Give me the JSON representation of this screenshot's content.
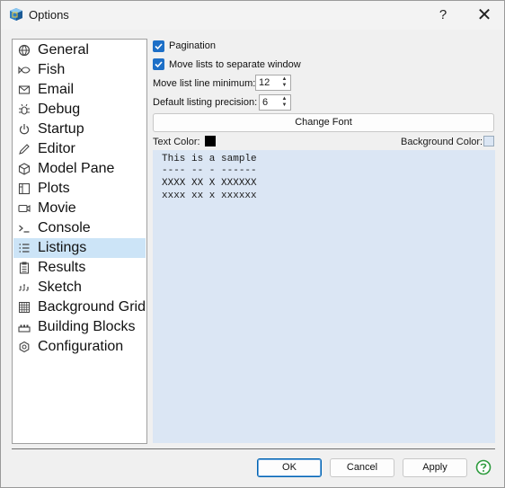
{
  "window": {
    "title": "Options",
    "help_glyph": "?",
    "close_glyph": "✕"
  },
  "sidebar": {
    "items": [
      {
        "label": "General",
        "icon": "globe-icon"
      },
      {
        "label": "Fish",
        "icon": "fish-icon"
      },
      {
        "label": "Email",
        "icon": "envelope-icon"
      },
      {
        "label": "Debug",
        "icon": "bug-icon"
      },
      {
        "label": "Startup",
        "icon": "power-icon"
      },
      {
        "label": "Editor",
        "icon": "pencil-icon"
      },
      {
        "label": "Model Pane",
        "icon": "cube-icon"
      },
      {
        "label": "Plots",
        "icon": "plot-icon"
      },
      {
        "label": "Movie",
        "icon": "movie-icon"
      },
      {
        "label": "Console",
        "icon": "console-icon"
      },
      {
        "label": "Listings",
        "icon": "list-icon"
      },
      {
        "label": "Results",
        "icon": "clipboard-icon"
      },
      {
        "label": "Sketch",
        "icon": "sketch-icon"
      },
      {
        "label": "Background Grid",
        "icon": "grid-icon"
      },
      {
        "label": "Building Blocks",
        "icon": "blocks-icon"
      },
      {
        "label": "Configuration",
        "icon": "config-icon"
      }
    ],
    "selected": "Listings"
  },
  "listings": {
    "pagination_label": "Pagination",
    "pagination_checked": true,
    "move_lists_label": "Move lists to separate window",
    "move_lists_checked": true,
    "move_list_line_min_label": "Move list line minimum:",
    "move_list_line_min_value": "12",
    "default_precision_label": "Default listing precision:",
    "default_precision_value": "6",
    "change_font_label": "Change Font",
    "text_color_label": "Text Color:",
    "text_color": "#000000",
    "background_color_label": "Background Color:",
    "background_color": "#dbe6f4",
    "sample_lines": [
      "This is a sample",
      "---- -- - ------",
      "XXXX XX X XXXXXX",
      "xxxx xx x xxxxxx"
    ]
  },
  "footer": {
    "ok_label": "OK",
    "cancel_label": "Cancel",
    "apply_label": "Apply"
  },
  "colors": {
    "accent": "#1d6fc7",
    "selected_row": "#cce4f7"
  }
}
